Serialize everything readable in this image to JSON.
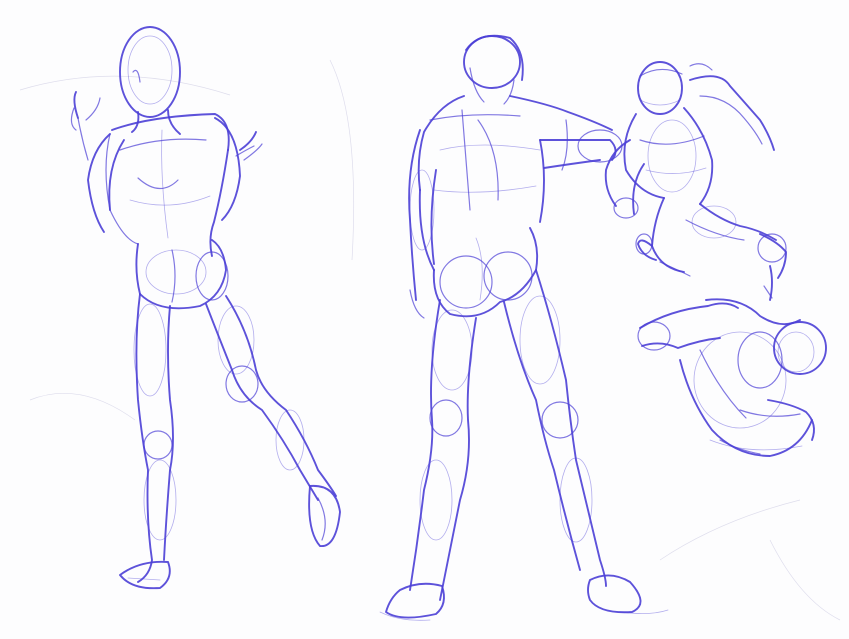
{
  "image": {
    "subject": "",
    "ink_color": "#4b3fd6",
    "paper_color": "#fdfdfe"
  },
  "figures": [
    {
      "id": "figure-back-view-left"
    },
    {
      "id": "figure-back-view-center"
    },
    {
      "id": "figure-leaping-right"
    },
    {
      "id": "figure-crouched-right"
    }
  ]
}
